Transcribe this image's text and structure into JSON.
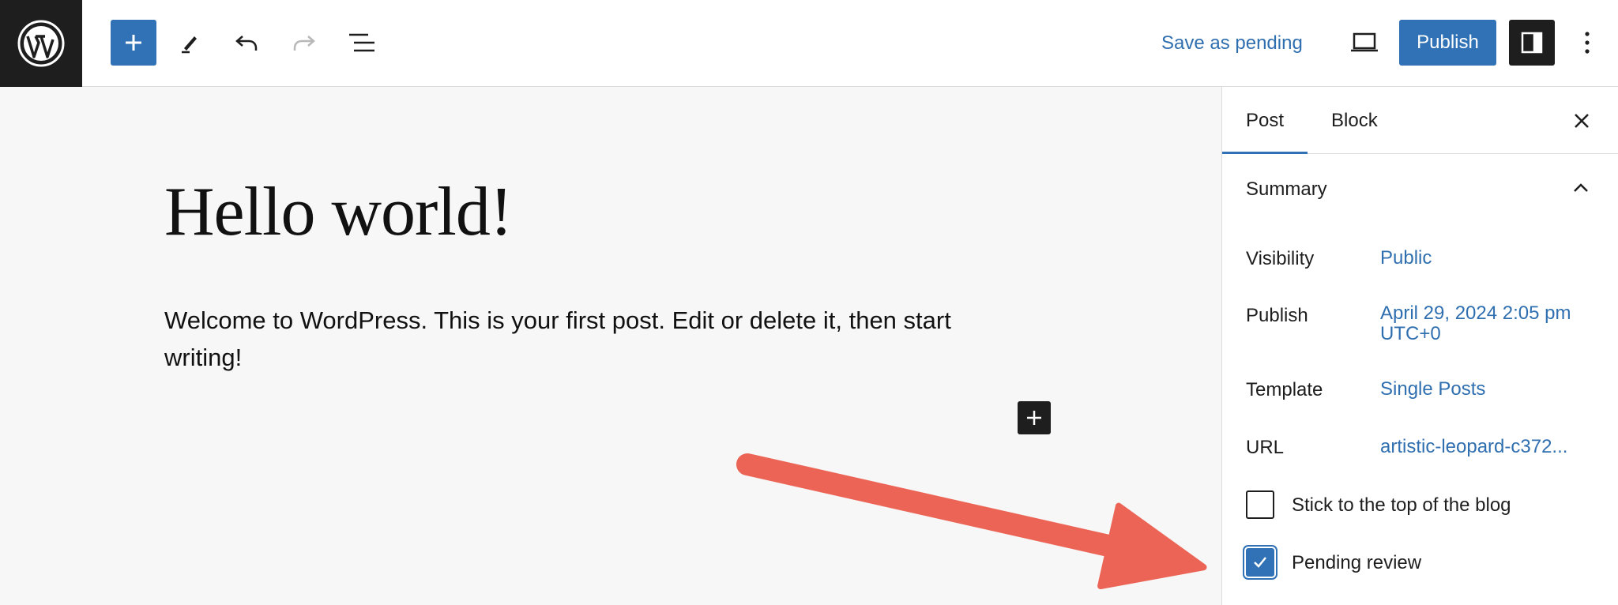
{
  "toolbar": {
    "save_pending_label": "Save as pending",
    "publish_label": "Publish",
    "accent_color": "#3072b5",
    "icons": [
      "wordpress-logo",
      "plus-icon",
      "pencil-icon",
      "undo-icon",
      "redo-icon",
      "list-view-icon",
      "desktop-preview-icon",
      "sidebar-icon",
      "more-options-icon"
    ]
  },
  "editor": {
    "post_title": "Hello world!",
    "post_body": "Welcome to WordPress. This is your first post. Edit or delete it, then start writing!"
  },
  "sidebar": {
    "tabs": [
      {
        "label": "Post",
        "active": true
      },
      {
        "label": "Block",
        "active": false
      }
    ],
    "summary_heading": "Summary",
    "rows": [
      {
        "label": "Visibility",
        "value": "Public"
      },
      {
        "label": "Publish",
        "value_line1": "April 29, 2024 2:05 pm",
        "value_line2": "UTC+0"
      },
      {
        "label": "Template",
        "value": "Single Posts"
      },
      {
        "label": "URL",
        "value": "artistic-leopard-c372..."
      }
    ],
    "checkboxes": [
      {
        "label": "Stick to the top of the blog",
        "checked": false
      },
      {
        "label": "Pending review",
        "checked": true
      }
    ]
  },
  "annotation": {
    "arrow_color": "#ec6455"
  }
}
